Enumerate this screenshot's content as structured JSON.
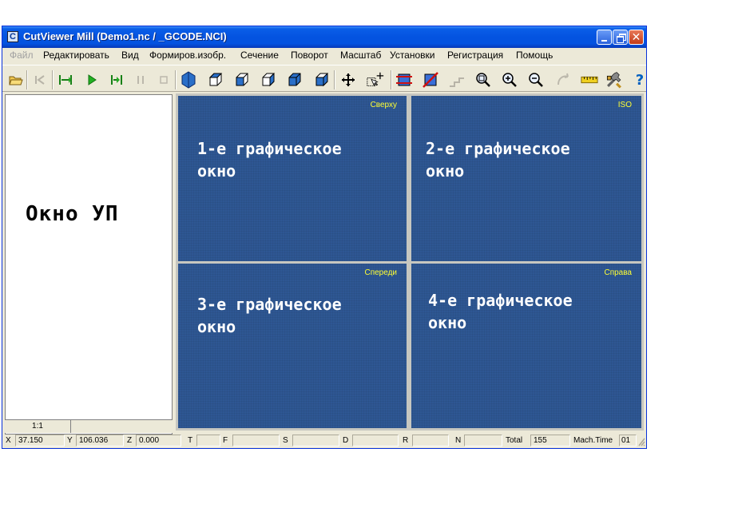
{
  "window": {
    "title": "CutViewer Mill (Demo1.nc / _GCODE.NCI)",
    "app_icon": "C"
  },
  "menu": {
    "items": [
      {
        "label": "Файл",
        "disabled": true
      },
      {
        "label": "Редактировать",
        "disabled": false
      },
      {
        "label": "Вид",
        "disabled": false
      },
      {
        "label": "Формиров.изобр.",
        "disabled": false
      },
      {
        "label": "Сечение",
        "disabled": false
      },
      {
        "label": "Поворот",
        "disabled": false
      },
      {
        "label": "Масштаб",
        "disabled": false
      },
      {
        "label": "Установки",
        "disabled": false
      },
      {
        "label": "Регистрация",
        "disabled": false
      },
      {
        "label": "Помощь",
        "disabled": false
      }
    ]
  },
  "toolbar": {
    "buttons": [
      "open-folder-icon",
      "step-back-icon",
      "rewind-start-icon",
      "play-icon",
      "step-forward-icon",
      "pause-icon",
      "stop-icon",
      "iso-view-solid-icon",
      "cube-view-1-icon",
      "cube-view-2-icon",
      "cube-view-3-icon",
      "cube-view-4-icon",
      "cube-view-5-icon",
      "pan-move-icon",
      "select-pointer-icon",
      "section-box-icon",
      "section-cut-icon",
      "section-steps-icon",
      "zoom-window-icon",
      "zoom-in-icon",
      "zoom-out-icon",
      "rotate-icon",
      "ruler-icon",
      "settings-tools-icon",
      "help-icon"
    ],
    "help_glyph": "?"
  },
  "left_pane": {
    "label": "Окно УП",
    "zoom": "1:1"
  },
  "graphics": {
    "w1": {
      "view": "Сверху",
      "line1": "1-е графическое",
      "line2": "окно"
    },
    "w2": {
      "view": "ISO",
      "line1": "2-е графическое",
      "line2": "окно"
    },
    "w3": {
      "view": "Спереди",
      "line1": "3-е графическое",
      "line2": "окно"
    },
    "w4": {
      "view": "Справа",
      "line1": "4-е графическое",
      "line2": "окно"
    }
  },
  "status": {
    "x_label": "X",
    "x_value": "37.150",
    "y_label": "Y",
    "y_value": "106.036",
    "z_label": "Z",
    "z_value": "0.000",
    "t_label": "T",
    "f_label": "F",
    "s_label": "S",
    "d_label": "D",
    "r_label": "R",
    "n_label": "N",
    "total_label": "Total",
    "total_value": "155",
    "mach_label": "Mach.Time",
    "mach_value": "01"
  },
  "colors": {
    "graphics_bg": "#2e5793",
    "view_label": "#ffff33",
    "title_bar": "#0453e0"
  }
}
